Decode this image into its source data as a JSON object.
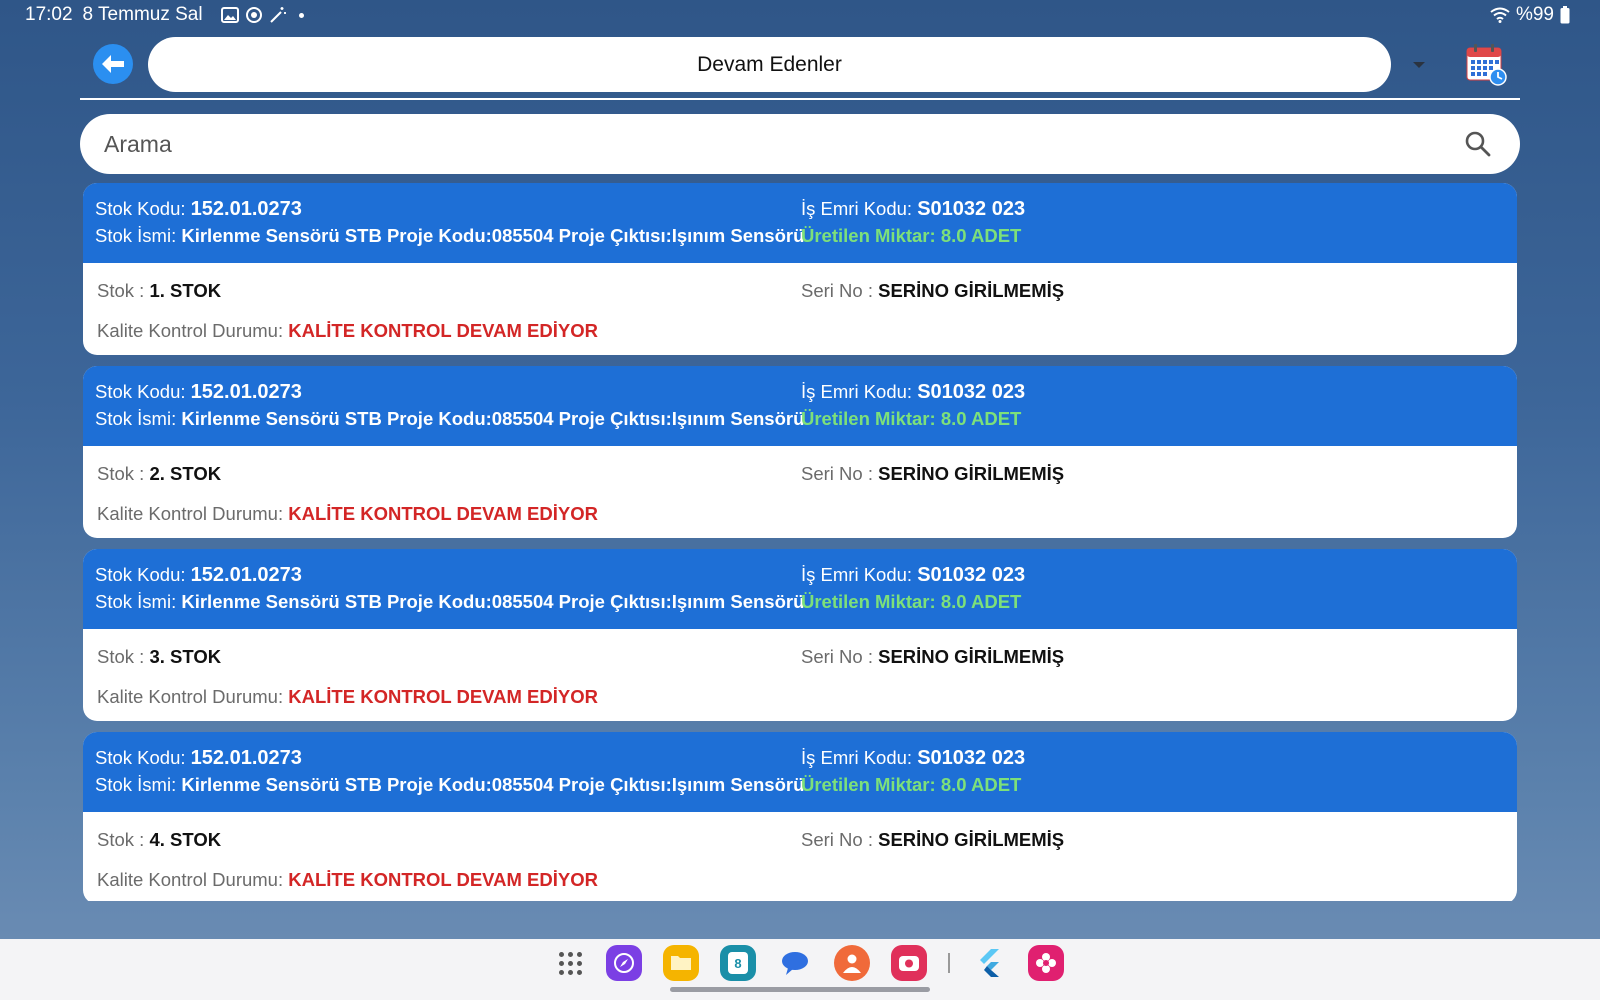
{
  "status_bar": {
    "time": "17:02",
    "date": "8 Temmuz Sal",
    "battery": "%99"
  },
  "header": {
    "title": "Devam Edenler"
  },
  "search": {
    "placeholder": "Arama"
  },
  "labels": {
    "stok_kodu": "Stok Kodu:",
    "stok_ismi": "Stok İsmi:",
    "is_emri_kodu": "İş Emri Kodu:",
    "uretilen_miktar": "Üretilen Miktar:",
    "stok": "Stok :",
    "seri_no": "Seri No :",
    "kalite_kontrol_durumu": "Kalite Kontrol Durumu:"
  },
  "cards": [
    {
      "stok_kodu": "152.01.0273",
      "stok_ismi": "Kirlenme Sensörü STB Proje Kodu:085504 Proje Çıktısı:Işınım Sensörü",
      "is_emri_kodu": "S01032 023",
      "uretilen_miktar": "8.0 ADET",
      "stok": "1. STOK",
      "seri_no": "SERİNO GİRİLMEMİŞ",
      "kalite_durumu": "KALİTE KONTROL DEVAM EDİYOR"
    },
    {
      "stok_kodu": "152.01.0273",
      "stok_ismi": "Kirlenme Sensörü STB Proje Kodu:085504 Proje Çıktısı:Işınım Sensörü",
      "is_emri_kodu": "S01032 023",
      "uretilen_miktar": "8.0 ADET",
      "stok": "2. STOK",
      "seri_no": "SERİNO GİRİLMEMİŞ",
      "kalite_durumu": "KALİTE KONTROL DEVAM EDİYOR"
    },
    {
      "stok_kodu": "152.01.0273",
      "stok_ismi": "Kirlenme Sensörü STB Proje Kodu:085504 Proje Çıktısı:Işınım Sensörü",
      "is_emri_kodu": "S01032 023",
      "uretilen_miktar": "8.0 ADET",
      "stok": "3. STOK",
      "seri_no": "SERİNO GİRİLMEMİŞ",
      "kalite_durumu": "KALİTE KONTROL DEVAM EDİYOR"
    },
    {
      "stok_kodu": "152.01.0273",
      "stok_ismi": "Kirlenme Sensörü STB Proje Kodu:085504 Proje Çıktısı:Işınım Sensörü",
      "is_emri_kodu": "S01032 023",
      "uretilen_miktar": "8.0 ADET",
      "stok": "4. STOK",
      "seri_no": "SERİNO GİRİLMEMİŞ",
      "kalite_durumu": "KALİTE KONTROL DEVAM EDİYOR"
    }
  ],
  "dock": {
    "apps": [
      {
        "icon": "app-drawer-icon"
      },
      {
        "icon": "browser-icon",
        "color": "#7b3fe4"
      },
      {
        "icon": "files-icon",
        "color": "#f5b400"
      },
      {
        "icon": "calendar-app-icon",
        "color": "#1a8fa8",
        "text": "8"
      },
      {
        "icon": "messages-icon",
        "color": "#2f6fe0"
      },
      {
        "icon": "contacts-icon",
        "color": "#f06a3a"
      },
      {
        "icon": "screen-recorder-icon",
        "color": "#e0305a"
      },
      {
        "icon": "flutter-icon",
        "color": "#3fb5f0"
      },
      {
        "icon": "blossom-app-icon",
        "color": "#e02070"
      }
    ]
  },
  "colors": {
    "card_header": "#1e6fd6",
    "quantity_green": "#7de07a",
    "status_red": "#d32626",
    "back_button": "#2b8ff0"
  }
}
